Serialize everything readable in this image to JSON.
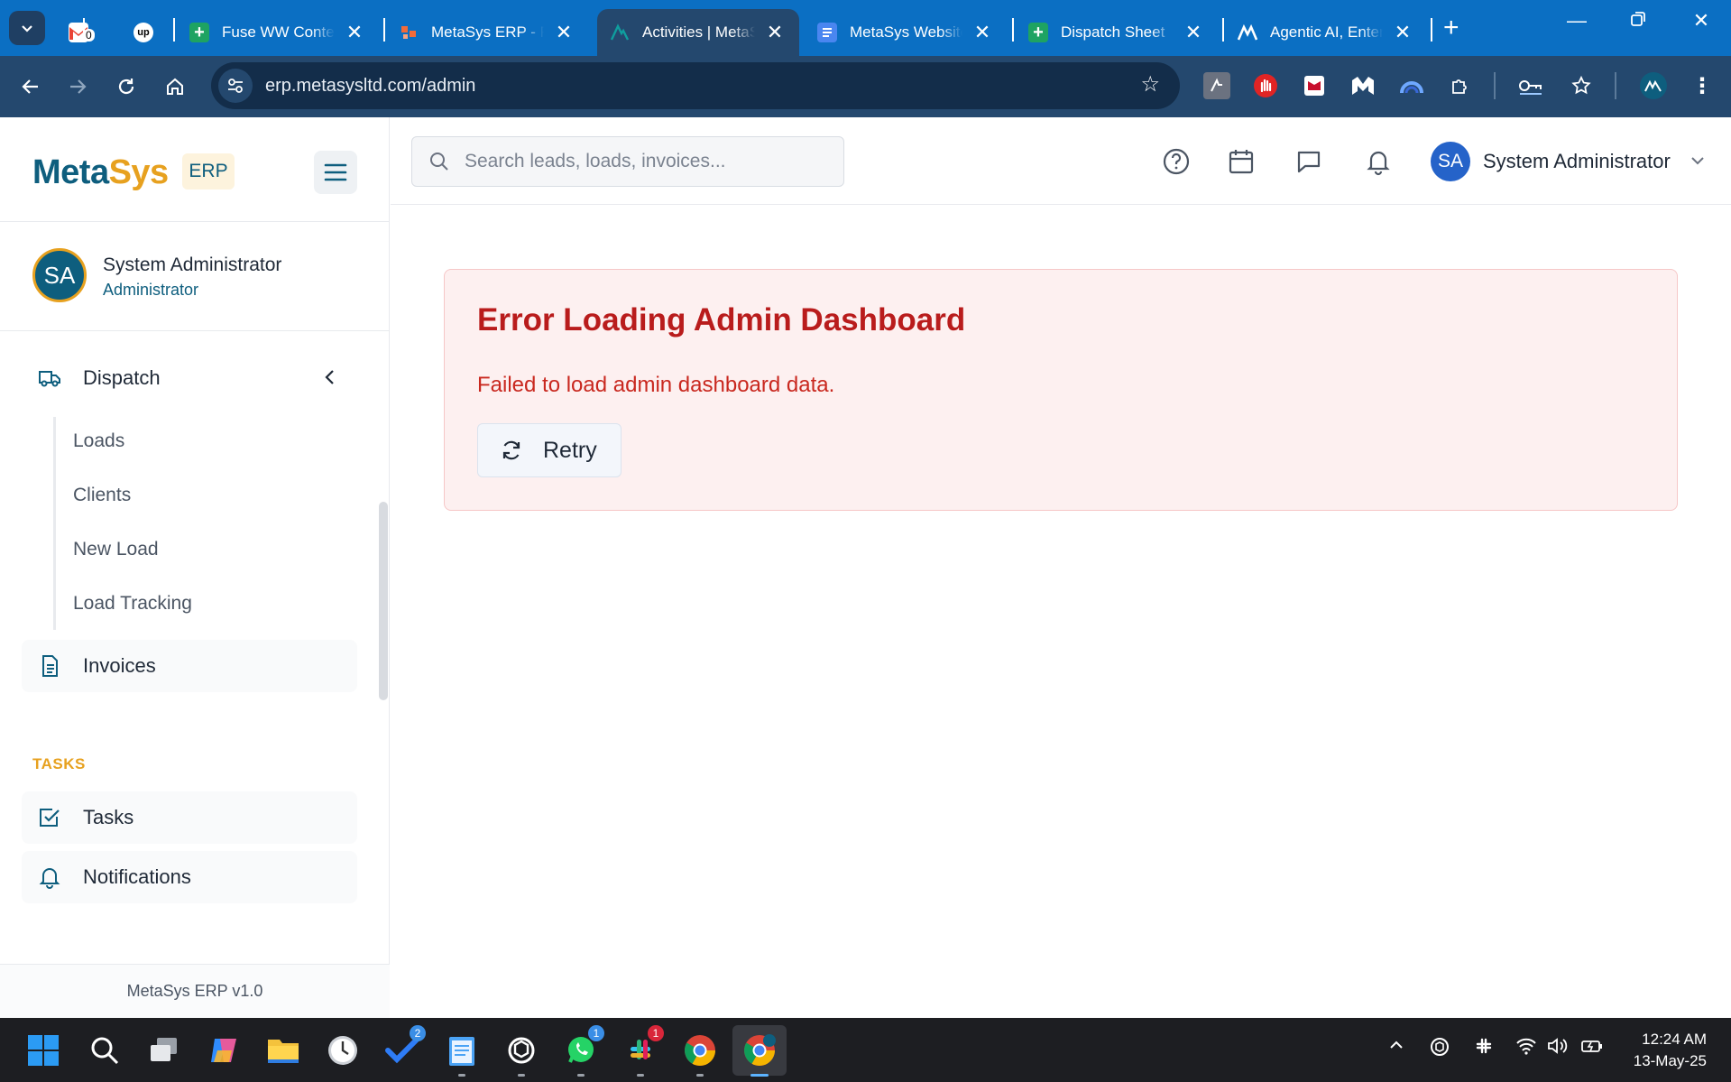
{
  "browser": {
    "tabs": [
      {
        "title": "",
        "icon": "gmail-icon",
        "badge": "0"
      },
      {
        "title": "",
        "icon": "upwork-icon"
      },
      {
        "title": "Fuse WW Content",
        "icon": "sheets-icon"
      },
      {
        "title": "MetaSys ERP - F",
        "icon": "metasys-tab-icon"
      },
      {
        "title": "Activities | MetaSys",
        "icon": "metasys-mountain-icon",
        "active": true
      },
      {
        "title": "MetaSys Website",
        "icon": "docs-icon"
      },
      {
        "title": "Dispatch Sheet",
        "icon": "sheets-icon"
      },
      {
        "title": "Agentic AI, Enterprise",
        "icon": "metasys-mountain-icon"
      }
    ],
    "url": "erp.metasysltd.com/admin",
    "colors": {
      "tabstrip": "#0b6fc3",
      "toolbar": "#24486e"
    }
  },
  "app": {
    "brand": {
      "part1": "Meta",
      "part2": "Sys",
      "badge": "ERP"
    },
    "search_placeholder": "Search leads, loads, invoices...",
    "header_user": {
      "initials": "SA",
      "name": "System Administrator"
    },
    "sidebar": {
      "user": {
        "initials": "SA",
        "name": "System Administrator",
        "role": "Administrator"
      },
      "dispatch": {
        "label": "Dispatch",
        "children": [
          "Loads",
          "Clients",
          "New Load",
          "Load Tracking"
        ]
      },
      "invoices": "Invoices",
      "tasks_section": "TASKS",
      "tasks": "Tasks",
      "notifications": "Notifications",
      "footer": "MetaSys ERP v1.0"
    },
    "error": {
      "title": "Error Loading Admin Dashboard",
      "message": "Failed to load admin dashboard data.",
      "retry": "Retry"
    },
    "colors": {
      "primary": "#0e5e7e",
      "accent": "#e7a11f",
      "error": "#b91c1c"
    }
  },
  "taskbar": {
    "badges": {
      "todo": "2",
      "whatsapp": "1",
      "slack": "1"
    },
    "clock": {
      "time": "12:24 AM",
      "date": "13-May-25"
    }
  }
}
